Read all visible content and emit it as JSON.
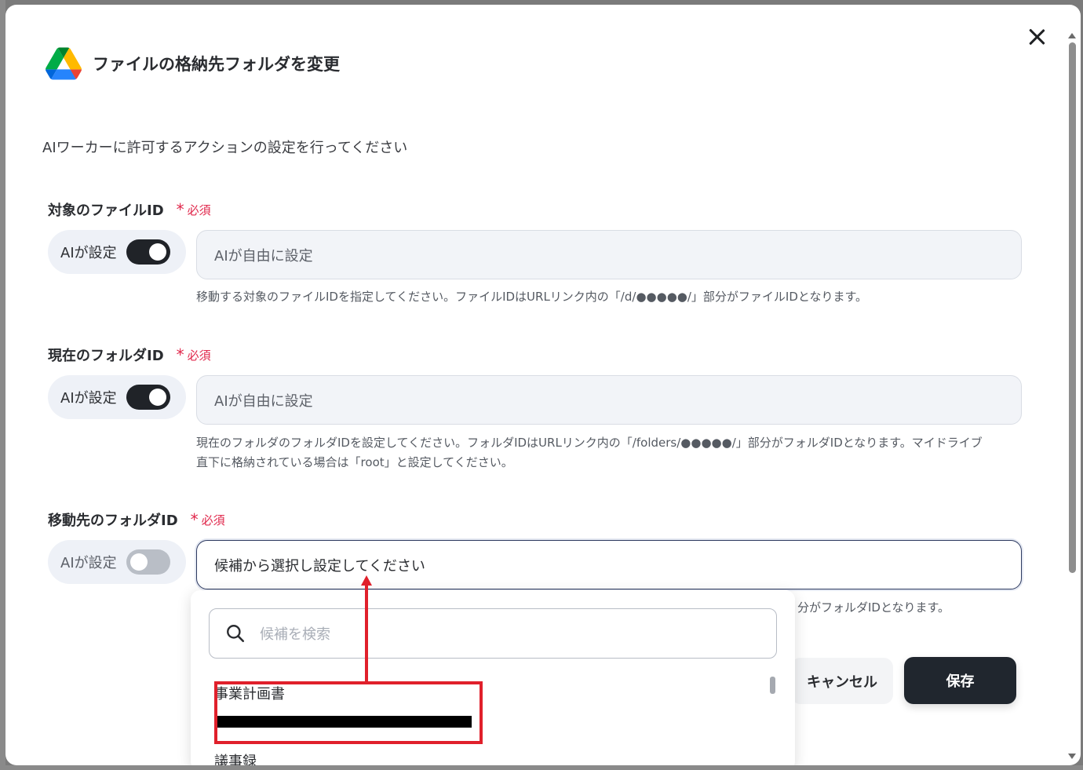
{
  "modal": {
    "title": "ファイルの格納先フォルダを変更",
    "subtitle": "AIワーカーに許可するアクションの設定を行ってください",
    "required_label": "必須",
    "ai_toggle_label": "AIが設定"
  },
  "fields": [
    {
      "label": "対象のファイルID",
      "ai_enabled": true,
      "value": "AIが自由に設定",
      "help": "移動する対象のファイルIDを指定してください。ファイルIDはURLリンク内の「/d/●●●●●/」部分がファイルIDとなります。"
    },
    {
      "label": "現在のフォルダID",
      "ai_enabled": true,
      "value": "AIが自由に設定",
      "help_line1": "現在のフォルダのフォルダIDを設定してください。フォルダIDはURLリンク内の「/folders/●●●●●/」部分がフォルダIDとなります。マイドライブ",
      "help_line2": "直下に格納されている場合は「root」と設定してください。"
    },
    {
      "label": "移動先のフォルダID",
      "ai_enabled": false,
      "value": "候補から選択し設定してください",
      "help_partial": "分がフォルダIDとなります。"
    }
  ],
  "dropdown": {
    "search_placeholder": "候補を検索",
    "options": [
      {
        "label": "事業計画書"
      },
      {
        "label": "議事録"
      }
    ]
  },
  "buttons": {
    "cancel": "キャンセル",
    "save": "保存"
  },
  "colors": {
    "required": "#e0274b",
    "annotation": "#e0202b",
    "save_button": "#20262e"
  }
}
